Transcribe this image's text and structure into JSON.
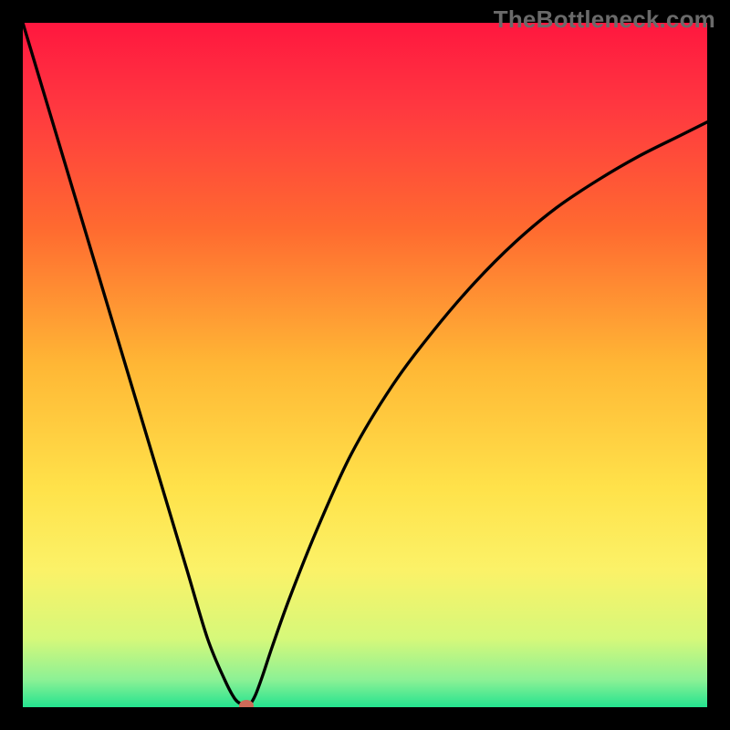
{
  "watermark": "TheBottleneck.com",
  "chart_data": {
    "type": "line",
    "title": "",
    "xlabel": "",
    "ylabel": "",
    "xlim": [
      0,
      100
    ],
    "ylim": [
      0,
      100
    ],
    "grid": false,
    "legend": false,
    "background_gradient": {
      "stops": [
        {
          "offset": 0.0,
          "color": "#ff173f"
        },
        {
          "offset": 0.12,
          "color": "#ff3740"
        },
        {
          "offset": 0.3,
          "color": "#ff6a30"
        },
        {
          "offset": 0.5,
          "color": "#ffb735"
        },
        {
          "offset": 0.68,
          "color": "#ffe24a"
        },
        {
          "offset": 0.8,
          "color": "#fbf268"
        },
        {
          "offset": 0.9,
          "color": "#d6f87a"
        },
        {
          "offset": 0.96,
          "color": "#8cf195"
        },
        {
          "offset": 1.0,
          "color": "#24e38f"
        }
      ]
    },
    "series": [
      {
        "name": "bottleneck-curve",
        "color": "#000000",
        "x": [
          0.0,
          3.0,
          6.0,
          9.0,
          12.0,
          15.0,
          18.0,
          21.0,
          24.0,
          27.0,
          29.5,
          31.0,
          32.0,
          32.6,
          33.2,
          34.0,
          35.0,
          36.5,
          39.0,
          43.0,
          48.0,
          54.0,
          60.0,
          66.0,
          72.0,
          78.0,
          84.0,
          90.0,
          96.0,
          100.0
        ],
        "y": [
          100.0,
          90.0,
          80.0,
          70.0,
          60.0,
          50.0,
          40.0,
          30.0,
          20.0,
          10.0,
          4.0,
          1.2,
          0.4,
          0.0,
          0.4,
          1.8,
          4.5,
          9.0,
          16.0,
          26.0,
          37.0,
          47.0,
          55.0,
          62.0,
          68.0,
          73.0,
          77.0,
          80.5,
          83.5,
          85.5
        ]
      }
    ],
    "marker": {
      "name": "bottleneck-point",
      "x": 32.6,
      "y": 0.0,
      "color": "#cf6a58"
    }
  }
}
